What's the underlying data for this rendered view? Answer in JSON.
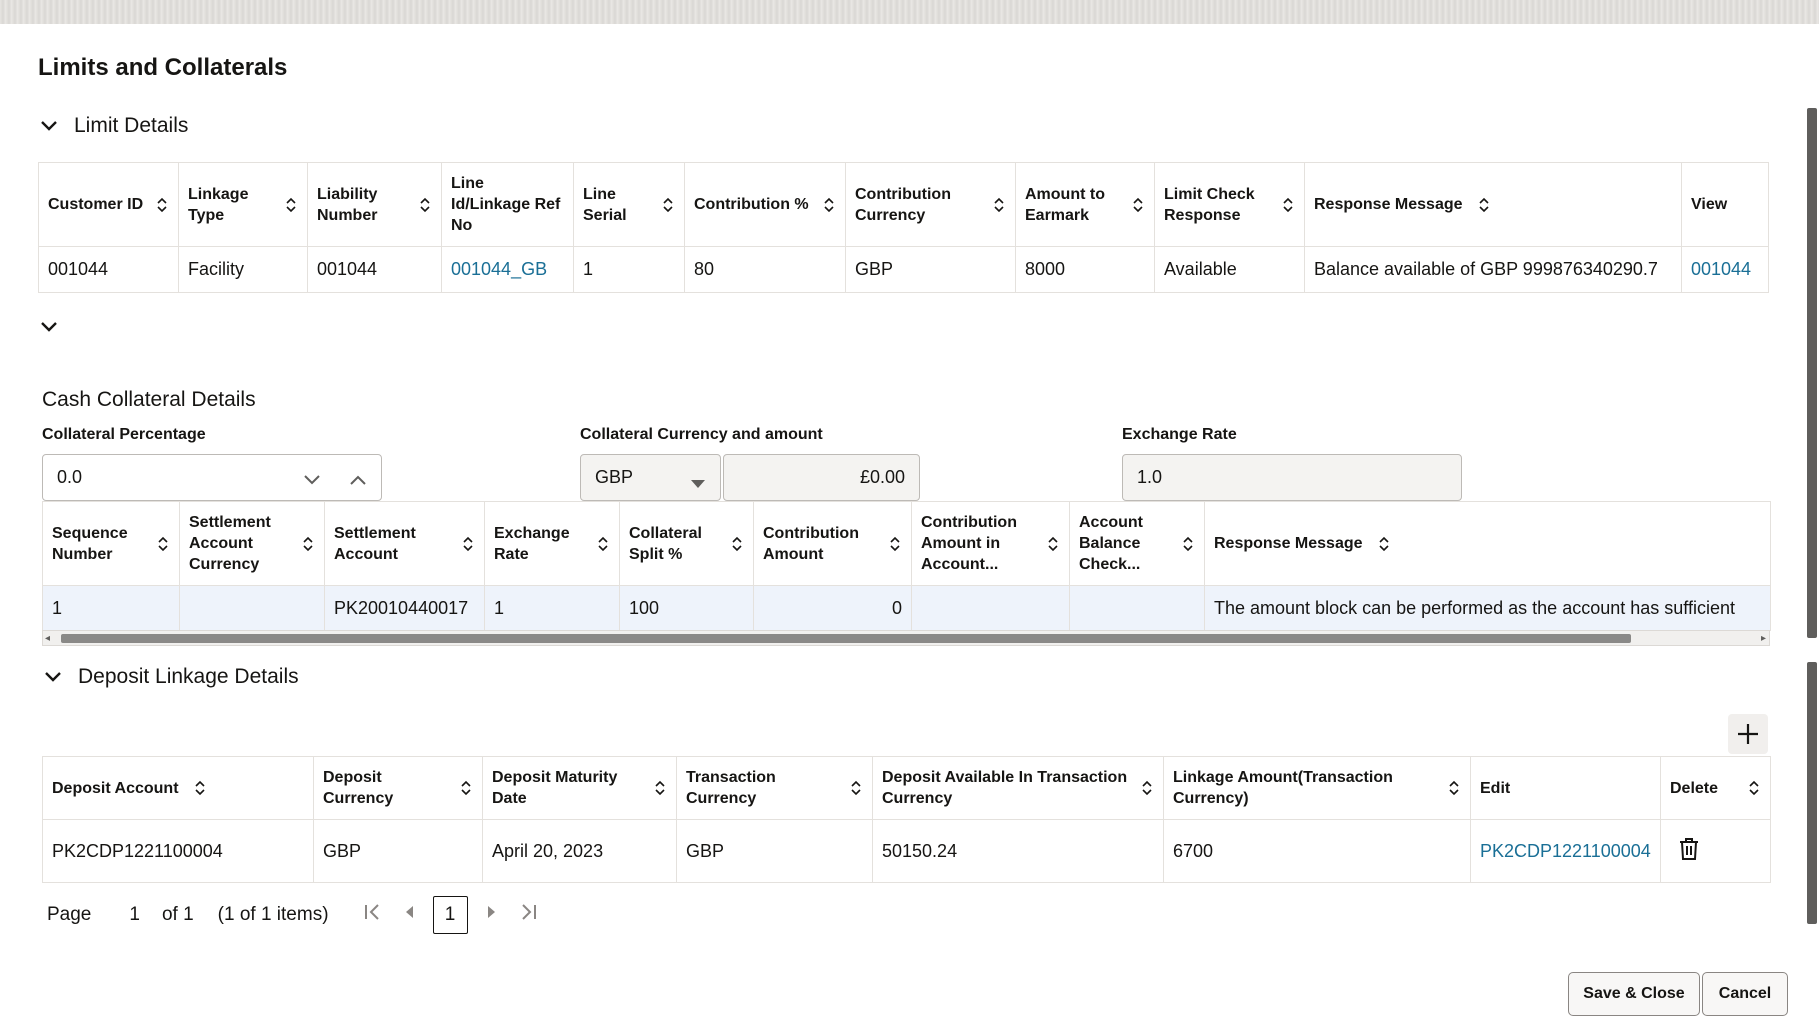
{
  "page_title": "Limits and Collaterals",
  "limit_details": {
    "section_title": "Limit Details",
    "columns": [
      "Customer ID",
      "Linkage Type",
      "Liability Number",
      "Line Id/Linkage Ref No",
      "Line Serial",
      "Contribution %",
      "Contribution Currency",
      "Amount to Earmark",
      "Limit Check Response",
      "Response Message",
      "View"
    ],
    "rows": [
      [
        "001044",
        "Facility",
        "001044",
        "001044_GB",
        "1",
        "80",
        "GBP",
        "8000",
        "Available",
        "Balance available of GBP 999876340290.7",
        "001044"
      ]
    ]
  },
  "cash_collateral": {
    "section_title": "Cash Collateral Details",
    "collateral_percentage_label": "Collateral Percentage",
    "collateral_percentage_value": "0.0",
    "currency_amount_label": "Collateral Currency and amount",
    "currency_value": "GBP",
    "amount_value": "£0.00",
    "exchange_rate_label": "Exchange Rate",
    "exchange_rate_value": "1.0",
    "columns": [
      "Sequence Number",
      "Settlement Account Currency",
      "Settlement Account",
      "Exchange Rate",
      "Collateral Split %",
      "Contribution Amount",
      "Contribution Amount in Account...",
      "Account Balance Check...",
      "Response Message"
    ],
    "rows": [
      [
        "1",
        "",
        "PK20010440017",
        "1",
        "100",
        "0",
        "",
        "",
        "The amount block can be performed as the account has sufficient"
      ]
    ]
  },
  "deposit_linkage": {
    "section_title": "Deposit Linkage Details",
    "columns": [
      "Deposit Account",
      "Deposit Currency",
      "Deposit Maturity Date",
      "Transaction Currency",
      "Deposit Available In Transaction Currency",
      "Linkage Amount(Transaction Currency)",
      "Edit",
      "Delete"
    ],
    "rows": [
      [
        "PK2CDP1221100004",
        "GBP",
        "April 20, 2023",
        "GBP",
        "50150.24",
        "6700",
        "PK2CDP1221100004",
        ""
      ]
    ]
  },
  "pagination": {
    "page_label": "Page",
    "page_value": "1",
    "of_label": "of 1",
    "items_label": "(1 of 1 items)",
    "current_page": "1"
  },
  "buttons": {
    "save_close": "Save & Close",
    "cancel": "Cancel"
  },
  "colors": {
    "link": "#1a6f96",
    "border": "#e4e1dd",
    "selected_row": "#eef3fb"
  }
}
